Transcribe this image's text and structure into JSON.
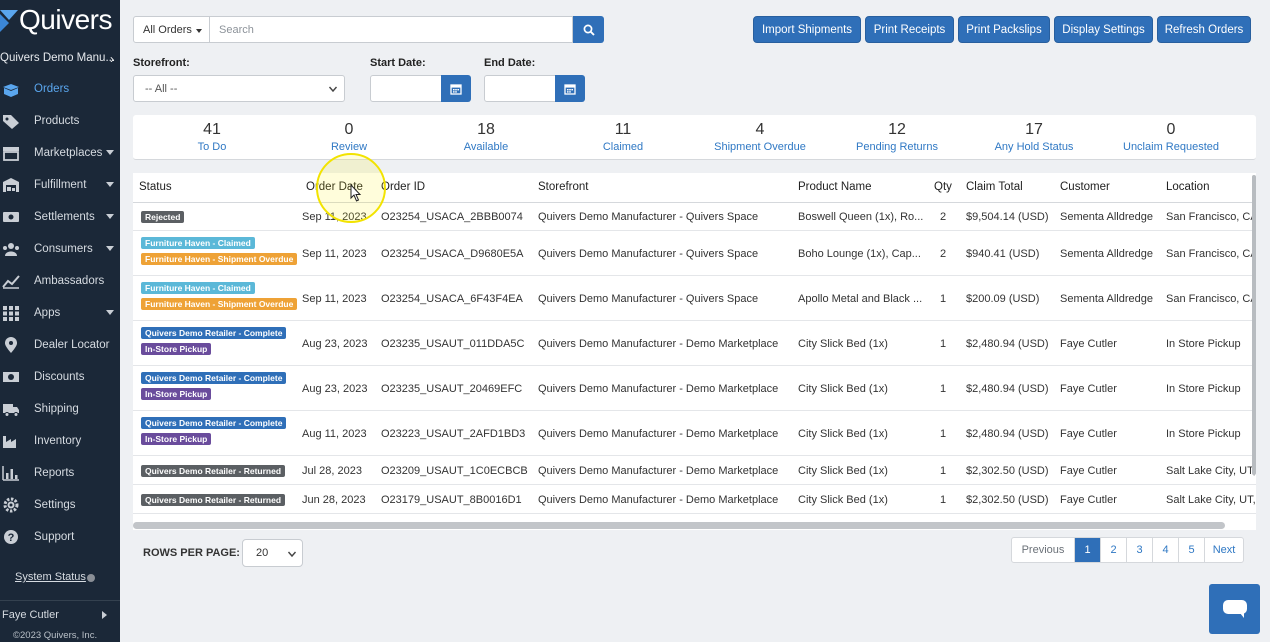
{
  "brand": {
    "name": "Quivers"
  },
  "sidebar": {
    "org": "Quivers Demo Manu...",
    "items": [
      {
        "label": "Orders",
        "icon": "box-open-icon",
        "active": true,
        "caret": false
      },
      {
        "label": "Products",
        "icon": "tags-icon",
        "active": false,
        "caret": false
      },
      {
        "label": "Marketplaces",
        "icon": "store-icon",
        "active": false,
        "caret": true
      },
      {
        "label": "Fulfillment",
        "icon": "warehouse-icon",
        "active": false,
        "caret": true
      },
      {
        "label": "Settlements",
        "icon": "money-bill-icon",
        "active": false,
        "caret": true
      },
      {
        "label": "Consumers",
        "icon": "users-icon",
        "active": false,
        "caret": true
      },
      {
        "label": "Ambassadors",
        "icon": "chart-line-icon",
        "active": false,
        "caret": false
      },
      {
        "label": "Apps",
        "icon": "grid-icon",
        "active": false,
        "caret": true
      },
      {
        "label": "Dealer Locator",
        "icon": "map-pin-icon",
        "active": false,
        "caret": false
      },
      {
        "label": "Discounts",
        "icon": "money-icon",
        "active": false,
        "caret": false
      },
      {
        "label": "Shipping",
        "icon": "truck-icon",
        "active": false,
        "caret": false
      },
      {
        "label": "Inventory",
        "icon": "industry-icon",
        "active": false,
        "caret": false
      },
      {
        "label": "Reports",
        "icon": "bar-chart-icon",
        "active": false,
        "caret": false
      },
      {
        "label": "Settings",
        "icon": "gear-icon",
        "active": false,
        "caret": false
      },
      {
        "label": "Support",
        "icon": "question-circle-icon",
        "active": false,
        "caret": false
      }
    ],
    "system_status": "System Status",
    "user": "Faye Cutler",
    "copyright": "©2023 Quivers, Inc."
  },
  "toolbar": {
    "order_filter": "All Orders",
    "search_placeholder": "Search",
    "buttons": [
      "Import Shipments",
      "Print Receipts",
      "Print Packslips",
      "Display Settings",
      "Refresh Orders"
    ]
  },
  "filters": {
    "storefront_label": "Storefront:",
    "storefront_value": "-- All --",
    "start_label": "Start Date:",
    "end_label": "End Date:"
  },
  "stats": [
    {
      "count": "41",
      "label": "To Do"
    },
    {
      "count": "0",
      "label": "Review"
    },
    {
      "count": "18",
      "label": "Available"
    },
    {
      "count": "11",
      "label": "Claimed"
    },
    {
      "count": "4",
      "label": "Shipment Overdue"
    },
    {
      "count": "12",
      "label": "Pending Returns"
    },
    {
      "count": "17",
      "label": "Any Hold Status"
    },
    {
      "count": "0",
      "label": "Unclaim Requested"
    }
  ],
  "table": {
    "headers": [
      "Status",
      "Order Date",
      "Order ID",
      "Storefront",
      "Product Name",
      "Qty",
      "Claim Total",
      "Customer",
      "Location"
    ],
    "rows": [
      {
        "badges": [
          {
            "text": "Rejected",
            "color": "#5b5f63"
          }
        ],
        "date": "Sep 11, 2023",
        "order_id": "O23254_USACA_2BBB0074",
        "storefront": "Quivers Demo Manufacturer  -  Quivers Space",
        "product": "Boswell Queen (1x), Ro...",
        "qty": "2",
        "total": "$9,504.14 (USD)",
        "customer": "Sementa Alldredge",
        "location": "San Francisco, CA"
      },
      {
        "badges": [
          {
            "text": "Furniture Haven - Claimed",
            "color": "#5bb8d8"
          },
          {
            "text": "Furniture Haven - Shipment Overdue",
            "color": "#eea236"
          }
        ],
        "date": "Sep 11, 2023",
        "order_id": "O23254_USACA_D9680E5A",
        "storefront": "Quivers Demo Manufacturer  -  Quivers Space",
        "product": "Boho Lounge (1x), Cap...",
        "qty": "2",
        "total": "$940.41 (USD)",
        "customer": "Sementa Alldredge",
        "location": "San Francisco, CA"
      },
      {
        "badges": [
          {
            "text": "Furniture Haven - Claimed",
            "color": "#5bb8d8"
          },
          {
            "text": "Furniture Haven - Shipment Overdue",
            "color": "#eea236"
          }
        ],
        "date": "Sep 11, 2023",
        "order_id": "O23254_USACA_6F43F4EA",
        "storefront": "Quivers Demo Manufacturer  -  Quivers Space",
        "product": "Apollo Metal and Black ...",
        "qty": "1",
        "total": "$200.09 (USD)",
        "customer": "Sementa Alldredge",
        "location": "San Francisco, CA"
      },
      {
        "badges": [
          {
            "text": "Quivers Demo Retailer - Complete",
            "color": "#2f6fb8"
          },
          {
            "text": "In-Store Pickup",
            "color": "#6a4c9c"
          }
        ],
        "date": "Aug 23, 2023",
        "order_id": "O23235_USAUT_011DDA5C",
        "storefront": "Quivers Demo Manufacturer  -  Demo Marketplace",
        "product": "City Slick Bed (1x)",
        "qty": "1",
        "total": "$2,480.94 (USD)",
        "customer": "Faye Cutler",
        "location": "In Store Pickup"
      },
      {
        "badges": [
          {
            "text": "Quivers Demo Retailer - Complete",
            "color": "#2f6fb8"
          },
          {
            "text": "In-Store Pickup",
            "color": "#6a4c9c"
          }
        ],
        "date": "Aug 23, 2023",
        "order_id": "O23235_USAUT_20469EFC",
        "storefront": "Quivers Demo Manufacturer  -  Demo Marketplace",
        "product": "City Slick Bed (1x)",
        "qty": "1",
        "total": "$2,480.94 (USD)",
        "customer": "Faye Cutler",
        "location": "In Store Pickup"
      },
      {
        "badges": [
          {
            "text": "Quivers Demo Retailer - Complete",
            "color": "#2f6fb8"
          },
          {
            "text": "In-Store Pickup",
            "color": "#6a4c9c"
          }
        ],
        "date": "Aug 11, 2023",
        "order_id": "O23223_USAUT_2AFD1BD3",
        "storefront": "Quivers Demo Manufacturer  -  Demo Marketplace",
        "product": "City Slick Bed (1x)",
        "qty": "1",
        "total": "$2,480.94 (USD)",
        "customer": "Faye Cutler",
        "location": "In Store Pickup"
      },
      {
        "badges": [
          {
            "text": "Quivers Demo Retailer - Returned",
            "color": "#5b5f63"
          }
        ],
        "date": "Jul 28, 2023",
        "order_id": "O23209_USAUT_1C0ECBCB",
        "storefront": "Quivers Demo Manufacturer  -  Demo Marketplace",
        "product": "City Slick Bed (1x)",
        "qty": "1",
        "total": "$2,302.50 (USD)",
        "customer": "Faye Cutler",
        "location": "Salt Lake City, UT,"
      },
      {
        "badges": [
          {
            "text": "Quivers Demo Retailer - Returned",
            "color": "#5b5f63"
          }
        ],
        "date": "Jun 28, 2023",
        "order_id": "O23179_USAUT_8B0016D1",
        "storefront": "Quivers Demo Manufacturer  -  Demo Marketplace",
        "product": "City Slick Bed (1x)",
        "qty": "1",
        "total": "$2,302.50 (USD)",
        "customer": "Faye Cutler",
        "location": "Salt Lake City, UT,"
      }
    ]
  },
  "pagination": {
    "rows_label": "ROWS PER PAGE:",
    "rows_value": "20",
    "items": [
      "Previous",
      "1",
      "2",
      "3",
      "4",
      "5",
      "Next"
    ],
    "active": "1"
  },
  "colors": {
    "sidebar": "#1b2838",
    "primary": "#2f6fb8",
    "link": "#2f78c4"
  }
}
